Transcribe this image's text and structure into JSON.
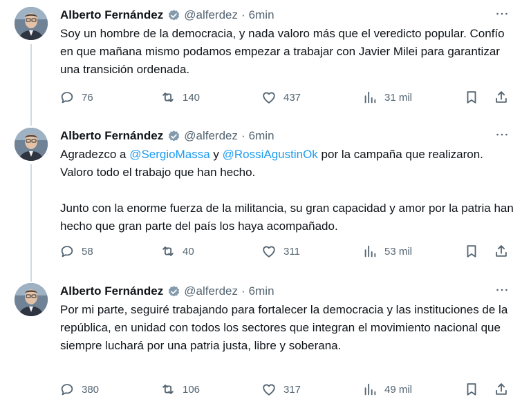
{
  "tweets": [
    {
      "author": "Alberto Fernández",
      "handle": "@alferdez",
      "separator": "·",
      "time": "6min",
      "paragraphs": [
        [
          {
            "text": "Soy un hombre de la democracia, y nada valoro más que el veredicto popular. Confío en que mañana mismo podamos empezar a trabajar con Javier Milei para garantizar una transición ordenada."
          }
        ]
      ],
      "stats": {
        "replies": "76",
        "retweets": "140",
        "likes": "437",
        "views": "31 mil"
      }
    },
    {
      "author": "Alberto Fernández",
      "handle": "@alferdez",
      "separator": "·",
      "time": "6min",
      "paragraphs": [
        [
          {
            "text": "Agradezco a "
          },
          {
            "text": "@SergioMassa",
            "mention": true
          },
          {
            "text": " y "
          },
          {
            "text": "@RossiAgustinOk",
            "mention": true
          },
          {
            "text": " por la campaña que realizaron. Valoro todo el trabajo que han hecho."
          }
        ],
        [
          {
            "text": "Junto con la enorme fuerza de la militancia, su gran capacidad y amor por la patria han hecho que gran parte del país los haya acompañado."
          }
        ]
      ],
      "stats": {
        "replies": "58",
        "retweets": "40",
        "likes": "311",
        "views": "53 mil"
      }
    },
    {
      "author": "Alberto Fernández",
      "handle": "@alferdez",
      "separator": "·",
      "time": "6min",
      "paragraphs": [
        [
          {
            "text": "Por mi parte, seguiré trabajando para fortalecer la democracia y las instituciones de la república, en unidad con todos los sectores que integran el movimiento nacional que siempre luchará por una patria justa, libre y soberana."
          }
        ]
      ],
      "stats": {
        "replies": "380",
        "retweets": "106",
        "likes": "317",
        "views": "49 mil"
      }
    }
  ],
  "icons": {
    "verified": "verified-badge-icon",
    "more": "more-options-icon",
    "reply": "reply-icon",
    "retweet": "retweet-icon",
    "like": "like-icon",
    "views": "views-icon",
    "bookmark": "bookmark-icon",
    "share": "share-icon"
  },
  "colors": {
    "text": "#0f1419",
    "secondary": "#536471",
    "mention": "#1d9bf0",
    "thread_line": "#cfd9de",
    "verified_badge": "#829aab"
  }
}
